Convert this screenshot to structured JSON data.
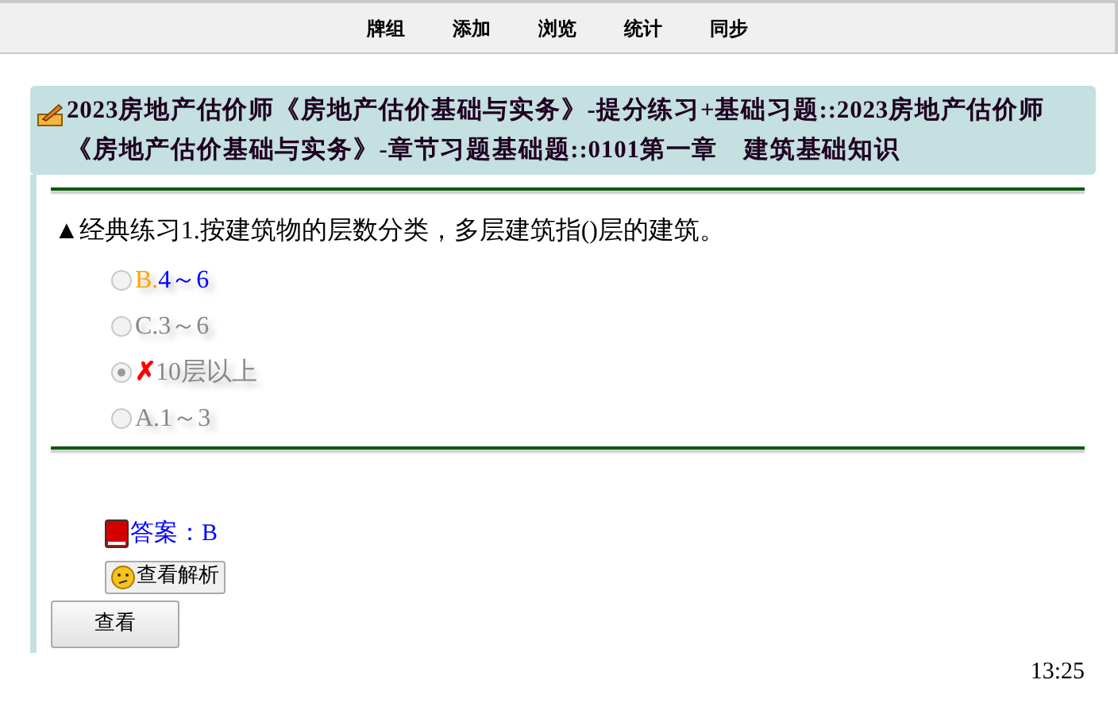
{
  "nav": [
    {
      "label": "牌组"
    },
    {
      "label": "添加"
    },
    {
      "label": "浏览"
    },
    {
      "label": "统计"
    },
    {
      "label": "同步"
    }
  ],
  "header": {
    "title": "2023房地产估价师《房地产估价基础与实务》-提分练习+基础习题::2023房地产估价师《房地产估价基础与实务》-章节习题基础题::0101第一章　建筑基础知识"
  },
  "question": {
    "marker": "▲",
    "text": "经典练习1.按建筑物的层数分类，多层建筑指()层的建筑。"
  },
  "options": [
    {
      "kind": "correct",
      "label": "B.",
      "text": "4～6",
      "selected": false
    },
    {
      "kind": "plain",
      "label": "C.",
      "text": "3～6",
      "selected": false
    },
    {
      "kind": "wrong",
      "mark": "✗",
      "text": "10层以上",
      "selected": true
    },
    {
      "kind": "plain",
      "label": "A.",
      "text": "1～3",
      "selected": false
    }
  ],
  "answer": {
    "text": "答案：B"
  },
  "analysis_button": {
    "label": "查看解析"
  },
  "view_button": {
    "label": "查看"
  },
  "time": "13:25"
}
